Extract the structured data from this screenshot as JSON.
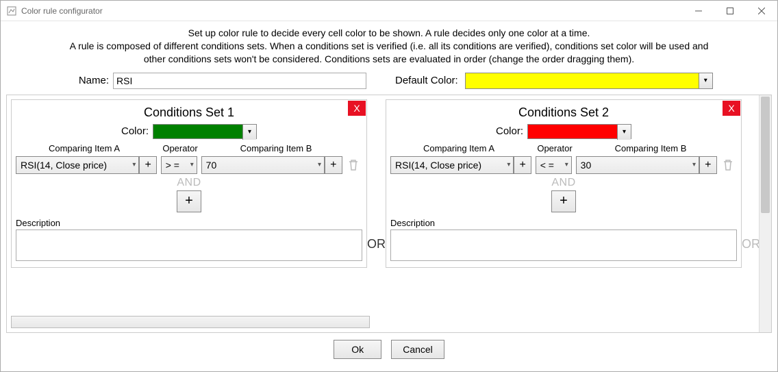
{
  "window": {
    "title": "Color rule configurator",
    "icon": "app-icon"
  },
  "help": {
    "line1": "Set up color rule to decide every cell color to be shown. A rule decides only one color at a time.",
    "line2": "A rule is composed of different conditions sets. When a conditions set is verified (i.e. all its conditions are verified), conditions set color will be used and",
    "line3": "other conditions sets won't be considered. Conditions sets are evaluated in order (change the order dragging them)."
  },
  "form": {
    "name_label": "Name:",
    "name_value": "RSI",
    "default_color_label": "Default Color:",
    "default_color": "#ffff00"
  },
  "or_label": "OR",
  "labels": {
    "color": "Color:",
    "comp_a": "Comparing Item A",
    "operator": "Operator",
    "comp_b": "Comparing Item B",
    "and": "AND",
    "description": "Description",
    "close_x": "X",
    "plus": "+"
  },
  "sets": [
    {
      "title": "Conditions Set 1",
      "color": "#008000",
      "conditions": [
        {
          "a": "RSI(14, Close price)",
          "op": "> =",
          "b": "70"
        }
      ],
      "description": ""
    },
    {
      "title": "Conditions Set 2",
      "color": "#ff0000",
      "conditions": [
        {
          "a": "RSI(14, Close price)",
          "op": "< =",
          "b": "30"
        }
      ],
      "description": ""
    }
  ],
  "footer": {
    "ok": "Ok",
    "cancel": "Cancel"
  }
}
